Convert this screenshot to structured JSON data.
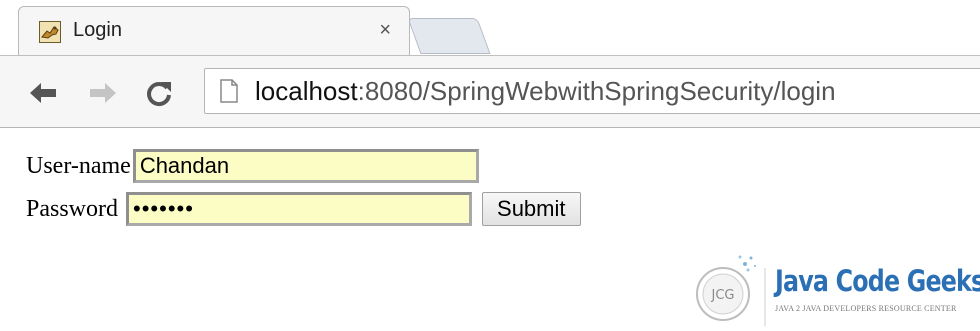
{
  "tab": {
    "title": "Login",
    "close_symbol": "×",
    "favicon": "tomcat-icon"
  },
  "toolbar": {
    "back_icon": "back-arrow-icon",
    "forward_icon": "forward-arrow-icon",
    "reload_icon": "reload-icon",
    "url_host": "localhost",
    "url_rest": ":8080/SpringWebwithSpringSecurity/login"
  },
  "form": {
    "username_label": "User-name",
    "username_value": "Chandan",
    "password_label": "Password",
    "password_value": "•••••••",
    "submit_label": "Submit"
  },
  "logo": {
    "brand": "Java Code Geeks",
    "tagline": "JAVA 2 JAVA DEVELOPERS RESOURCE CENTER",
    "emblem": "JCG"
  },
  "colors": {
    "field_background": "#fbfdc4",
    "brand_blue": "#2b6fb4"
  }
}
